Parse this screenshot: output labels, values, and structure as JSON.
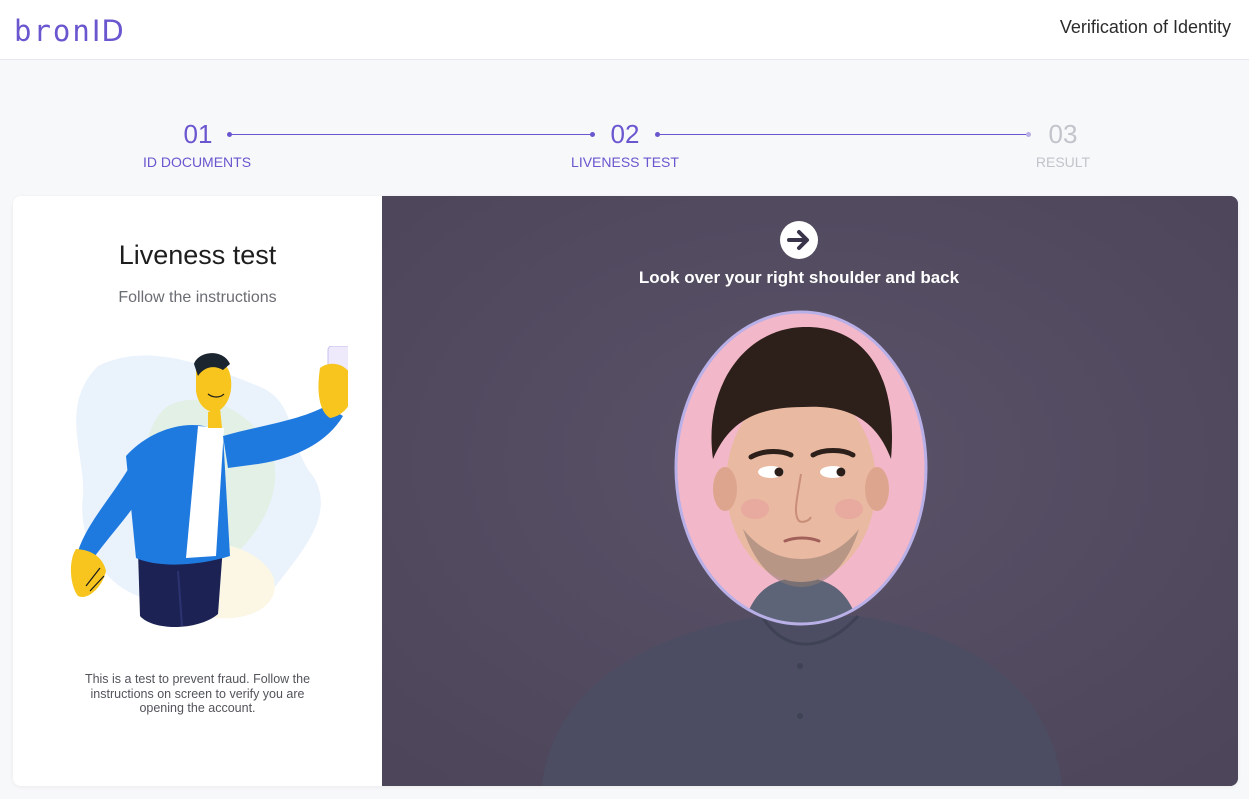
{
  "header": {
    "logo_text": "bron",
    "logo_id": "ID",
    "title": "Verification of Identity"
  },
  "stepper": {
    "steps": [
      {
        "number": "01",
        "label": "ID DOCUMENTS",
        "state": "done"
      },
      {
        "number": "02",
        "label": "LIVENESS TEST",
        "state": "active"
      },
      {
        "number": "03",
        "label": "RESULT",
        "state": "pending"
      }
    ]
  },
  "left_panel": {
    "title": "Liveness test",
    "subtitle": "Follow the instructions",
    "note": "This is a test to prevent fraud. Follow the instructions on screen to verify you are opening the account.",
    "illustration_icon": "selfie-person-illustration"
  },
  "right_panel": {
    "instruction_icon": "arrow-right-circle-icon",
    "instruction": "Look over your right shoulder and back",
    "face_frame_color": "#b9b0e8"
  },
  "colors": {
    "accent": "#6a56cf",
    "inactive": "#c2c4cb",
    "camera_overlay": "#524a60"
  }
}
